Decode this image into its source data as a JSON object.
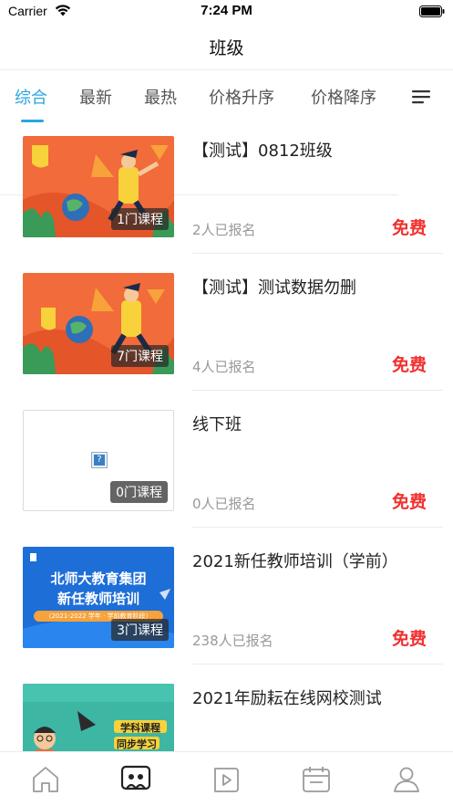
{
  "status_bar": {
    "carrier": "Carrier",
    "time": "7:24 PM"
  },
  "nav": {
    "title": "班级"
  },
  "tabs": [
    {
      "label": "综合",
      "active": true
    },
    {
      "label": "最新",
      "active": false
    },
    {
      "label": "最热",
      "active": false
    },
    {
      "label": "价格升序",
      "active": false
    },
    {
      "label": "价格降序",
      "active": false
    }
  ],
  "colors": {
    "accent": "#2aa7e0",
    "price": "#f23030",
    "muted": "#999999"
  },
  "classes": [
    {
      "title": "【测试】0812班级",
      "course_count": "1门课程",
      "enrolled": "2人已报名",
      "price": "免费",
      "thumb": "illustration-orange"
    },
    {
      "title": "【测试】测试数据勿删",
      "course_count": "7门课程",
      "enrolled": "4人已报名",
      "price": "免费",
      "thumb": "illustration-orange"
    },
    {
      "title": "线下班",
      "course_count": "0门课程",
      "enrolled": "0人已报名",
      "price": "免费",
      "thumb": "placeholder"
    },
    {
      "title": "2021新任教师培训（学前）",
      "course_count": "3门课程",
      "enrolled": "238人已报名",
      "price": "免费",
      "thumb": "blue-banner",
      "thumb_text": {
        "org": "北师大教育集团",
        "subtitle": "新任教师培训",
        "years": "（2021-2022 学年 · 学前教育阶段）"
      }
    },
    {
      "title": "2021年励耘在线网校测试",
      "thumb": "teal-illustration",
      "thumb_text": {
        "line1": "学科课程",
        "line2": "同步学习"
      }
    }
  ],
  "tabbar": [
    {
      "name": "home-icon",
      "active": false
    },
    {
      "name": "class-icon",
      "active": true
    },
    {
      "name": "video-icon",
      "active": false
    },
    {
      "name": "calendar-icon",
      "active": false
    },
    {
      "name": "profile-icon",
      "active": false
    }
  ]
}
